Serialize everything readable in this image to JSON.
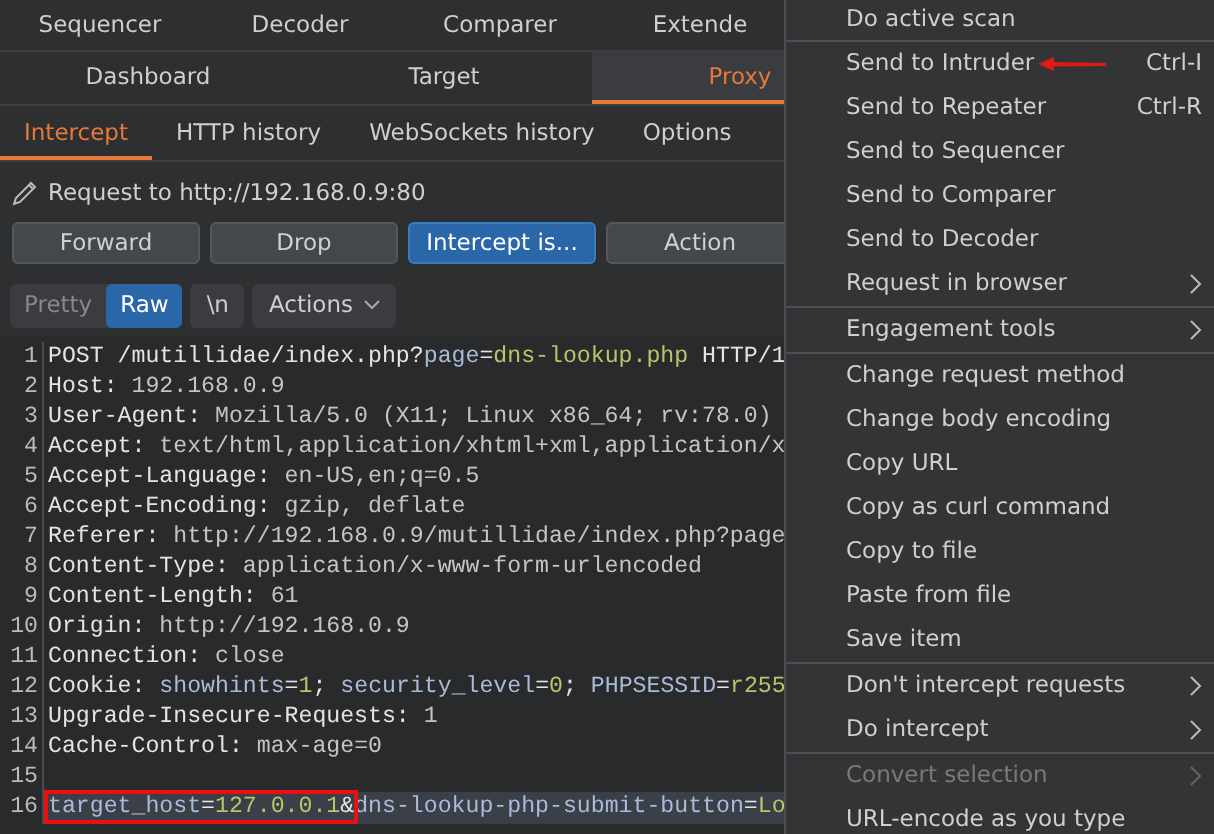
{
  "tool_tabs": [
    {
      "label": "Sequencer",
      "selected": false
    },
    {
      "label": "Decoder",
      "selected": false
    },
    {
      "label": "Comparer",
      "selected": false
    },
    {
      "label": "Extende",
      "selected": false
    }
  ],
  "main_tabs": [
    {
      "label": "Dashboard",
      "selected": false
    },
    {
      "label": "Target",
      "selected": false
    },
    {
      "label": "Proxy",
      "selected": true
    }
  ],
  "proxy_tabs": [
    {
      "label": "Intercept",
      "selected": true
    },
    {
      "label": "HTTP history",
      "selected": false
    },
    {
      "label": "WebSockets history",
      "selected": false
    },
    {
      "label": "Options",
      "selected": false
    }
  ],
  "request_label": "Request to http://192.168.0.9:80",
  "buttons": [
    {
      "label": "Forward",
      "primary": false
    },
    {
      "label": "Drop",
      "primary": false
    },
    {
      "label": "Intercept is...",
      "primary": true
    },
    {
      "label": "Action",
      "primary": false
    }
  ],
  "view_modes": [
    {
      "label": "Pretty",
      "selected": false
    },
    {
      "label": "Raw",
      "selected": true
    }
  ],
  "newline_toggle": "\\n",
  "actions_menu": "Actions",
  "lines": [
    {
      "number": "1",
      "highlight": false,
      "parts": [
        {
          "kind": "key",
          "text": "POST /mutillidae/index.php?"
        },
        {
          "kind": "param",
          "text": "page"
        },
        {
          "kind": "key",
          "text": "="
        },
        {
          "kind": "pval",
          "text": "dns-lookup.php"
        },
        {
          "kind": "key",
          "text": " HTTP/1"
        }
      ]
    },
    {
      "number": "2",
      "highlight": false,
      "parts": [
        {
          "kind": "key",
          "text": "Host:"
        },
        {
          "kind": "value",
          "text": " 192.168.0.9"
        }
      ]
    },
    {
      "number": "3",
      "highlight": false,
      "parts": [
        {
          "kind": "key",
          "text": "User-Agent:"
        },
        {
          "kind": "value",
          "text": " Mozilla/5.0 (X11; Linux x86_64; rv:78.0)"
        }
      ]
    },
    {
      "number": "4",
      "highlight": false,
      "parts": [
        {
          "kind": "key",
          "text": "Accept:"
        },
        {
          "kind": "value",
          "text": " text/html,application/xhtml+xml,application/x"
        }
      ]
    },
    {
      "number": "5",
      "highlight": false,
      "parts": [
        {
          "kind": "key",
          "text": "Accept-Language:"
        },
        {
          "kind": "value",
          "text": " en-US,en;q=0.5"
        }
      ]
    },
    {
      "number": "6",
      "highlight": false,
      "parts": [
        {
          "kind": "key",
          "text": "Accept-Encoding:"
        },
        {
          "kind": "value",
          "text": " gzip, deflate"
        }
      ]
    },
    {
      "number": "7",
      "highlight": false,
      "parts": [
        {
          "kind": "key",
          "text": "Referer:"
        },
        {
          "kind": "value",
          "text": " http://192.168.0.9/mutillidae/index.php?page"
        }
      ]
    },
    {
      "number": "8",
      "highlight": false,
      "parts": [
        {
          "kind": "key",
          "text": "Content-Type:"
        },
        {
          "kind": "value",
          "text": " application/x-www-form-urlencoded"
        }
      ]
    },
    {
      "number": "9",
      "highlight": false,
      "parts": [
        {
          "kind": "key",
          "text": "Content-Length:"
        },
        {
          "kind": "value",
          "text": " 61"
        }
      ]
    },
    {
      "number": "10",
      "highlight": false,
      "parts": [
        {
          "kind": "key",
          "text": "Origin:"
        },
        {
          "kind": "value",
          "text": " http://192.168.0.9"
        }
      ]
    },
    {
      "number": "11",
      "highlight": false,
      "parts": [
        {
          "kind": "key",
          "text": "Connection:"
        },
        {
          "kind": "value",
          "text": " close"
        }
      ]
    },
    {
      "number": "12",
      "highlight": false,
      "parts": [
        {
          "kind": "key",
          "text": "Cookie: "
        },
        {
          "kind": "param",
          "text": "showhints"
        },
        {
          "kind": "key",
          "text": "="
        },
        {
          "kind": "pval",
          "text": "1"
        },
        {
          "kind": "key",
          "text": "; "
        },
        {
          "kind": "param",
          "text": "security_level"
        },
        {
          "kind": "key",
          "text": "="
        },
        {
          "kind": "pval",
          "text": "0"
        },
        {
          "kind": "key",
          "text": "; "
        },
        {
          "kind": "param",
          "text": "PHPSESSID"
        },
        {
          "kind": "key",
          "text": "="
        },
        {
          "kind": "pval",
          "text": "r255"
        }
      ]
    },
    {
      "number": "13",
      "highlight": false,
      "parts": [
        {
          "kind": "key",
          "text": "Upgrade-Insecure-Requests:"
        },
        {
          "kind": "value",
          "text": " 1"
        }
      ]
    },
    {
      "number": "14",
      "highlight": false,
      "parts": [
        {
          "kind": "key",
          "text": "Cache-Control:"
        },
        {
          "kind": "value",
          "text": " max-age=0"
        }
      ]
    },
    {
      "number": "15",
      "highlight": false
    },
    {
      "number": "16",
      "highlight": true,
      "parts": [
        {
          "kind": "param",
          "text": "target_host"
        },
        {
          "kind": "key",
          "text": "="
        },
        {
          "kind": "pval",
          "text": "127.0.0.1"
        },
        {
          "kind": "key",
          "text": "&"
        },
        {
          "kind": "param",
          "text": "dns-lookup-php-submit-button"
        },
        {
          "kind": "key",
          "text": "="
        },
        {
          "kind": "pval",
          "text": "Lo"
        }
      ]
    }
  ],
  "context_menu": [
    [
      {
        "label": "Do active scan",
        "disabled": false,
        "submenu": false
      }
    ],
    [
      {
        "label": "Send to Intruder",
        "shortcut": "Ctrl-I",
        "disabled": false,
        "submenu": false,
        "pointed": true
      },
      {
        "label": "Send to Repeater",
        "shortcut": "Ctrl-R",
        "disabled": false,
        "submenu": false
      },
      {
        "label": "Send to Sequencer",
        "disabled": false,
        "submenu": false
      },
      {
        "label": "Send to Comparer",
        "disabled": false,
        "submenu": false
      },
      {
        "label": "Send to Decoder",
        "disabled": false,
        "submenu": false
      },
      {
        "label": "Request in browser",
        "disabled": false,
        "submenu": true
      }
    ],
    [
      {
        "label": "Engagement tools",
        "disabled": false,
        "submenu": true
      }
    ],
    [
      {
        "label": "Change request method",
        "disabled": false,
        "submenu": false
      },
      {
        "label": "Change body encoding",
        "disabled": false,
        "submenu": false
      },
      {
        "label": "Copy URL",
        "disabled": false,
        "submenu": false
      },
      {
        "label": "Copy as curl command",
        "disabled": false,
        "submenu": false
      },
      {
        "label": "Copy to file",
        "disabled": false,
        "submenu": false
      },
      {
        "label": "Paste from file",
        "disabled": false,
        "submenu": false
      },
      {
        "label": "Save item",
        "disabled": false,
        "submenu": false
      }
    ],
    [
      {
        "label": "Don't intercept requests",
        "disabled": false,
        "submenu": true
      },
      {
        "label": "Do intercept",
        "disabled": false,
        "submenu": true
      }
    ],
    [
      {
        "label": "Convert selection",
        "disabled": true,
        "submenu": true
      },
      {
        "label": "URL-encode as you type",
        "disabled": false,
        "submenu": false
      }
    ]
  ]
}
